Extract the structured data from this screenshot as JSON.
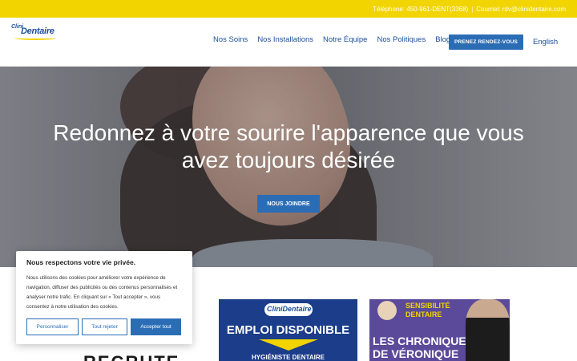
{
  "topbar": {
    "phone": "Téléphone: 450-961-DENT(3368)",
    "separator": "|",
    "email": "Courriel: rdv@clinidentaire.com"
  },
  "logo": {
    "part1": "Clini",
    "part2": "Dentaire"
  },
  "nav": {
    "items": [
      {
        "label": "Nos Soins"
      },
      {
        "label": "Nos Installations"
      },
      {
        "label": "Notre Équipe"
      },
      {
        "label": "Nos Politiques"
      },
      {
        "label": "Blogue"
      }
    ],
    "cta_label": "PRENEZ RENDEZ-VOUS",
    "language_label": "English"
  },
  "hero": {
    "heading": "Redonnez à votre sourire l'apparence que vous avez toujours désirée",
    "button_label": "NOUS JOINDRE"
  },
  "cards": {
    "left_text": "RECRUTE",
    "job_card": {
      "logo_text": "CliniDentaire",
      "title": "EMPLOI DISPONIBLE",
      "subtitle": "HYGIÉNISTE DENTAIRE"
    },
    "blog_card": {
      "tag_line1": "SENSIBILITÉ",
      "tag_line2": "DENTAIRE",
      "title_line1": "LES CHRONIQUES",
      "title_line2": "DE VÉRONIQUE"
    }
  },
  "cookie_banner": {
    "title": "Nous respectons votre vie privée.",
    "body": "Nous utilisons des cookies pour améliorer votre expérience de navigation, diffuser des publicités ou des contenus personnalisés et analyser notre trafic. En cliquant sur « Tout accepter », vous consentez à notre utilisation des cookies.",
    "customize_label": "Personnaliser",
    "reject_label": "Tout rejeter",
    "accept_label": "Accepter tout"
  },
  "colors": {
    "topbar_yellow": "#f1d400",
    "brand_blue": "#2b6db5",
    "nav_text_blue": "#1b4f9c"
  }
}
